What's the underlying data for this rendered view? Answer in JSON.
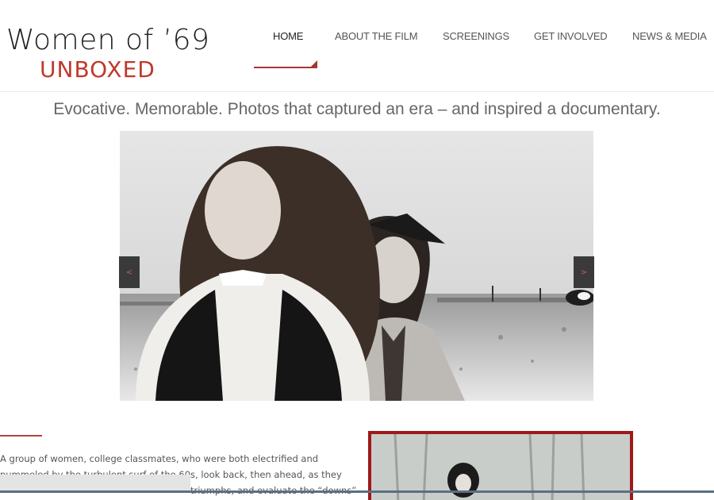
{
  "logo": {
    "line1": "Women of ’69",
    "line2": "UNBOXED"
  },
  "nav": {
    "items": [
      {
        "label": "HOME",
        "active": true
      },
      {
        "label": "ABOUT THE FILM",
        "active": false
      },
      {
        "label": "SCREENINGS",
        "active": false
      },
      {
        "label": "GET INVOLVED",
        "active": false
      },
      {
        "label": "NEWS & MEDIA",
        "active": false
      }
    ]
  },
  "tagline": "Evocative. Memorable. Photos that captured an era – and inspired a documentary.",
  "slider": {
    "prev_label": "<",
    "next_label": ">"
  },
  "intro": {
    "line1": "A group of women, college classmates, who were both electrified and",
    "line2": "pummeled by the turbulent surf of the 60s, look back, then ahead, as they",
    "line3": "triumphs, and evaluate the “downs”"
  },
  "colors": {
    "accent_red": "#a33a2e",
    "logo_red": "#c0392b",
    "frame_red": "#a01818"
  }
}
